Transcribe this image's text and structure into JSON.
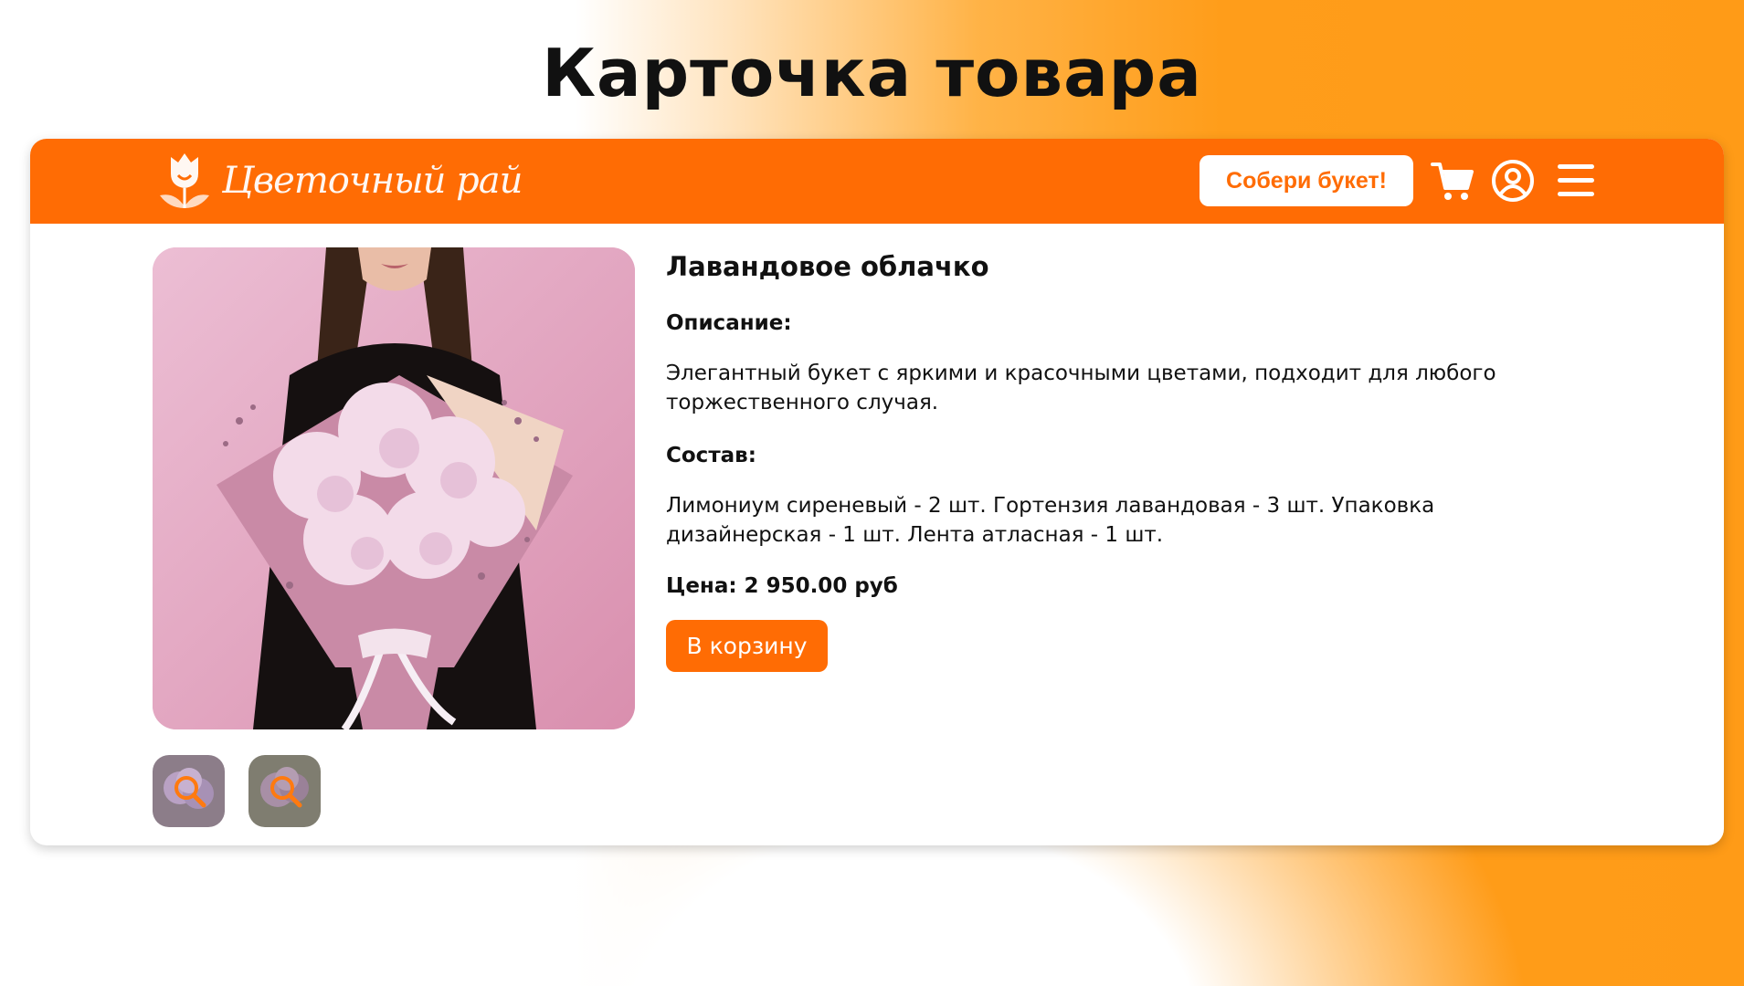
{
  "slide": {
    "title": "Карточка товара"
  },
  "header": {
    "logo_text": "Цветочный рай",
    "build_button": "Собери букет!",
    "icons": [
      "cart-icon",
      "user-icon",
      "menu-icon"
    ]
  },
  "product": {
    "name": "Лавандовое облачко",
    "description_label": "Описание:",
    "description": "Элегантный букет с яркими и красочными цветами, подходит для любого торжественного случая.",
    "composition_label": "Состав:",
    "composition": "Лимониум сиреневый - 2 шт. Гортензия лавандовая - 3 шт. Упаковка дизайнерская - 1 шт. Лента атласная - 1 шт.",
    "price": "Цена: 2 950.00 руб",
    "add_to_cart": "В корзину",
    "thumbnails": [
      "thumb-1",
      "thumb-2"
    ]
  },
  "colors": {
    "accent": "#ff6c04",
    "bg_gradient": "#ff9b17",
    "photo_bg": "#e3a8c0"
  }
}
